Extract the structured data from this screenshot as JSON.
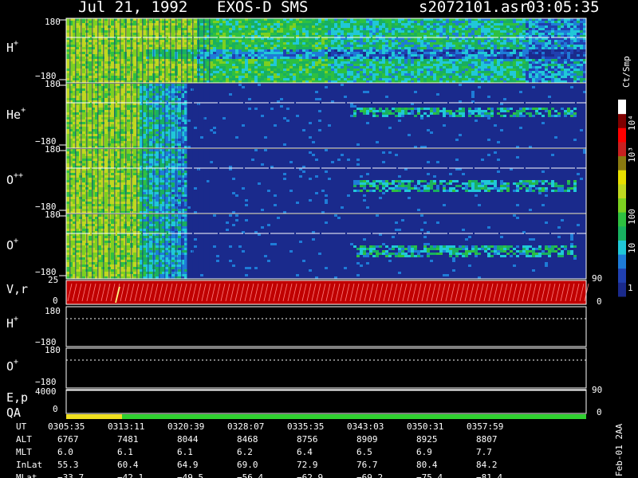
{
  "header": {
    "date": "Jul 21, 1992",
    "instrument": "EXOS-D SMS",
    "file": "s2072101.asr",
    "time": "03:05:35"
  },
  "colorbar": {
    "unit_label": "Ct/Smp",
    "tick_labels": [
      "1",
      "10",
      "100",
      "10³",
      "10⁴"
    ],
    "colors": [
      "#1a2a8c",
      "#2040b0",
      "#1e7cd8",
      "#20c8d8",
      "#18b060",
      "#2ec040",
      "#7cd020",
      "#c0d820",
      "#e8e000",
      "#8a7a10",
      "#c82020",
      "#ff0000",
      "#800000",
      "#ffffff"
    ]
  },
  "panels": [
    {
      "label_base": "H",
      "label_sup": "+",
      "tick_top": "180",
      "tick_bottom": "−180"
    },
    {
      "label_base": "He",
      "label_sup": "+",
      "tick_top": "180",
      "tick_bottom": "−180"
    },
    {
      "label_base": "O",
      "label_sup": "++",
      "tick_top": "180",
      "tick_bottom": "−180"
    },
    {
      "label_base": "O",
      "label_sup": "+",
      "tick_top": "180",
      "tick_bottom": "−180"
    }
  ],
  "vr_panel": {
    "label": "V,r",
    "tick_top": "25",
    "tick_bottom": "0",
    "right_top": "90",
    "right_bottom": "0"
  },
  "h_lower": {
    "label_base": "H",
    "label_sup": "+",
    "tick_top": "180",
    "tick_bottom": "−180"
  },
  "o_lower": {
    "label_base": "O",
    "label_sup": "+",
    "tick_top": "180",
    "tick_bottom": "−180"
  },
  "ep_panel": {
    "label1": "E,p",
    "label2": "QA",
    "tick_top": "4000",
    "tick_bottom": "0",
    "right_top": "90",
    "right_bottom": "0"
  },
  "table": {
    "rows": [
      {
        "name": "UT",
        "values": [
          "0305:35",
          "0313:11",
          "0320:39",
          "0328:07",
          "0335:35",
          "0343:03",
          "0350:31",
          "0357:59"
        ]
      },
      {
        "name": "ALT",
        "values": [
          "6767",
          "7481",
          "8044",
          "8468",
          "8756",
          "8909",
          "8925",
          "8807"
        ]
      },
      {
        "name": "MLT",
        "values": [
          "6.0",
          "6.1",
          "6.1",
          "6.2",
          "6.4",
          "6.5",
          "6.9",
          "7.7"
        ]
      },
      {
        "name": "InLat",
        "values": [
          "55.3",
          "60.4",
          "64.9",
          "69.0",
          "72.9",
          "76.7",
          "80.4",
          "84.2"
        ]
      },
      {
        "name": "MLat",
        "values": [
          "−33.7",
          "−42.1",
          "−49.5",
          "−56.4",
          "−62.9",
          "−69.2",
          "−75.4",
          "−81.4"
        ]
      }
    ]
  },
  "footer": {
    "stamp": "Feb-01 2AA"
  },
  "chart_data": {
    "type": "heatmap",
    "title": "EXOS-D SMS",
    "x": [
      "0305:35",
      "0313:11",
      "0320:39",
      "0328:07",
      "0335:35",
      "0343:03",
      "0350:31",
      "0357:59"
    ],
    "panels": [
      "H+",
      "He+",
      "O++",
      "O+"
    ],
    "ylim": [
      -180,
      180
    ],
    "colorscale": "log",
    "zlim": [
      1,
      10000
    ]
  }
}
